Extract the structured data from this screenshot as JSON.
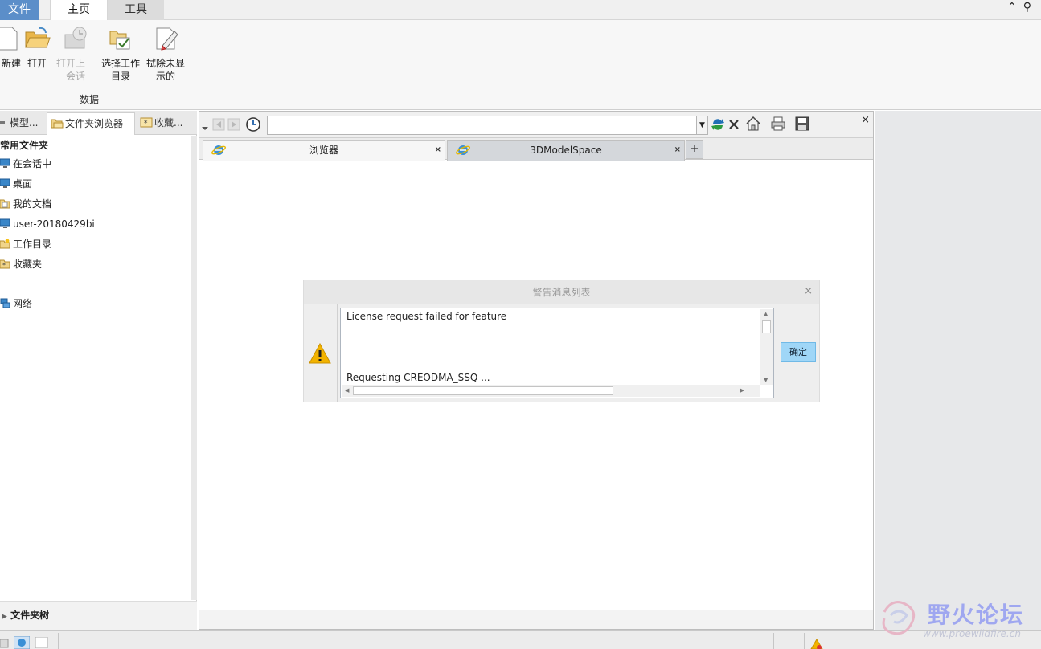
{
  "ribbon": {
    "tabs": [
      {
        "label": "文件"
      },
      {
        "label": "主页"
      },
      {
        "label": "工具"
      }
    ],
    "buttons": [
      {
        "label_line1": "新建",
        "label_line2": ""
      },
      {
        "label_line1": "打开",
        "label_line2": ""
      },
      {
        "label_line1": "打开上一",
        "label_line2": "会话"
      },
      {
        "label_line1": "选择工作",
        "label_line2": "目录"
      },
      {
        "label_line1": "拭除未显",
        "label_line2": "示的"
      }
    ],
    "group_label": "数据"
  },
  "left_panel": {
    "tabs": [
      {
        "label": "模型..."
      },
      {
        "label": "文件夹浏览器"
      },
      {
        "label": "收藏..."
      }
    ],
    "header": "常用文件夹",
    "items": [
      {
        "label": "在会话中"
      },
      {
        "label": "桌面"
      },
      {
        "label": "我的文档"
      },
      {
        "label": "user-20180429bi"
      },
      {
        "label": "工作目录"
      },
      {
        "label": "收藏夹"
      },
      {
        "label": "网络"
      }
    ],
    "tree_label": "文件夹树"
  },
  "browser": {
    "address_value": "",
    "tabs": [
      {
        "label": "浏览器"
      },
      {
        "label": "3DModelSpace"
      }
    ],
    "add_tab": "+",
    "close_glyph": "×"
  },
  "dialog": {
    "title": "警告消息列表",
    "message_line1": "License request failed for feature",
    "message_line2": "Requesting CREODMA_SSQ ...",
    "ok_label": "确定",
    "close_glyph": "×"
  },
  "watermark": {
    "text": "野火论坛",
    "url": "www.proewildfire.cn"
  },
  "colors": {
    "file_tab": "#5b8ec9",
    "ok_button": "#9fd6f7",
    "warning": "#f2b300",
    "watermark": "#9fa7f0"
  }
}
